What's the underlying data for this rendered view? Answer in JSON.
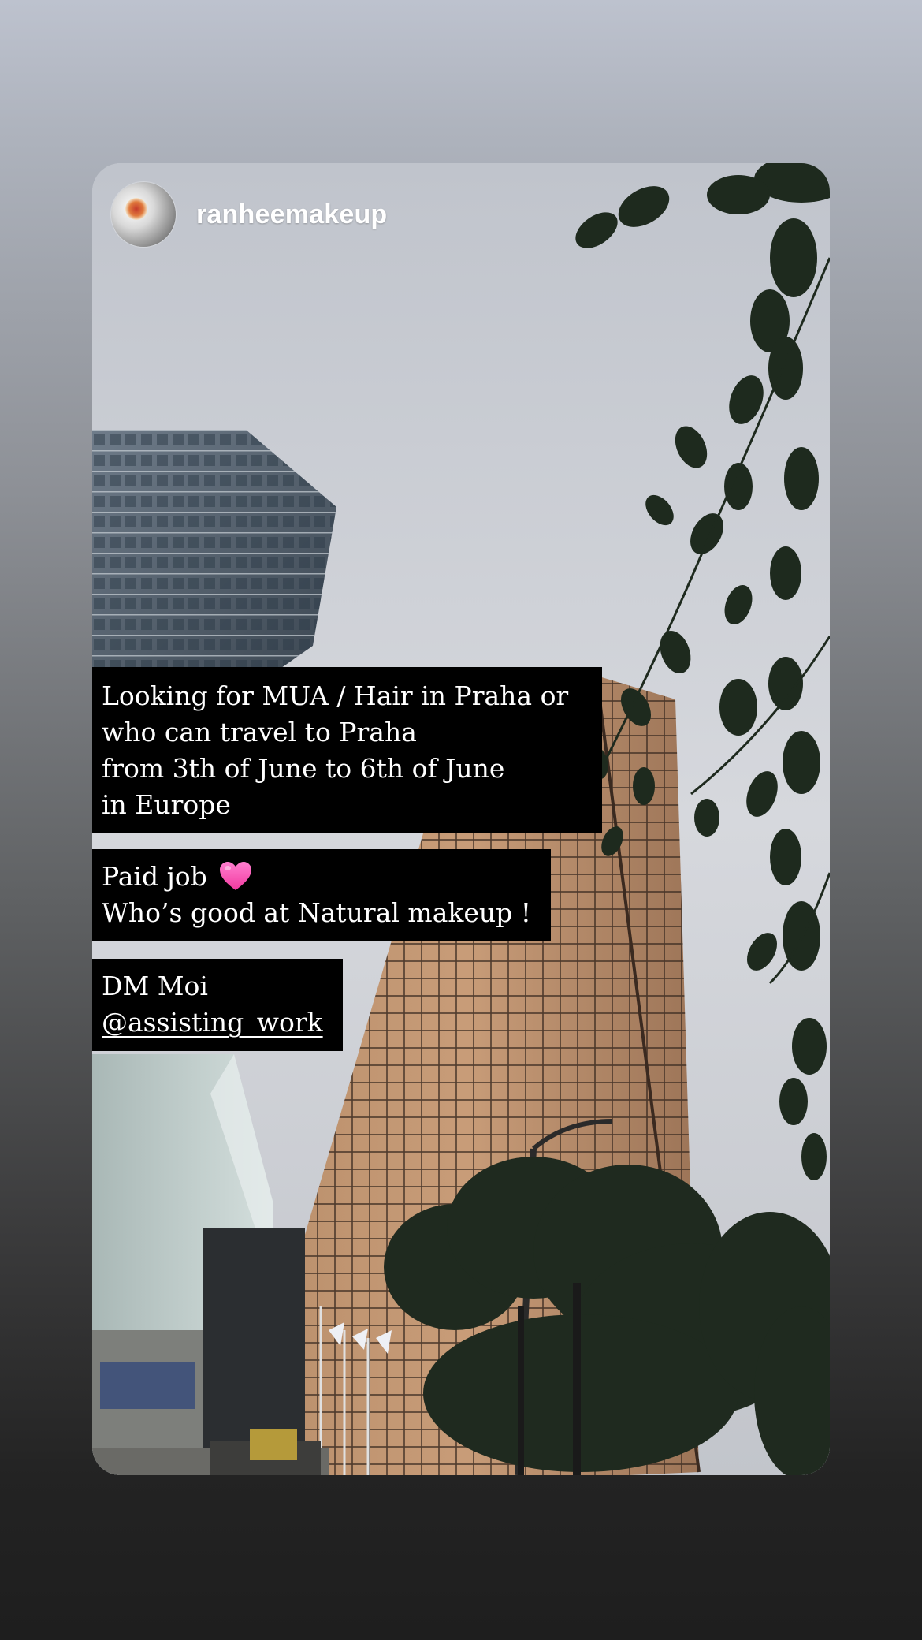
{
  "story": {
    "username": "ranheemakeup",
    "caption_block_1": [
      "Looking for MUA / Hair in Praha or",
      "who can travel to Praha",
      "from 3th of June to 6th of June",
      "in Europe"
    ],
    "caption_block_2": {
      "line_1": "Paid job",
      "line_2": "Who’s good at Natural makeup !"
    },
    "caption_block_3": {
      "line_1": "DM Moi",
      "mention": "@assisting_work"
    }
  },
  "icons": {
    "heart": "pink-heart-icon",
    "avatar": "avatar"
  },
  "colors": {
    "caption_background": "#000000",
    "caption_text": "#ffffff",
    "heart": "#ff5fb8"
  }
}
